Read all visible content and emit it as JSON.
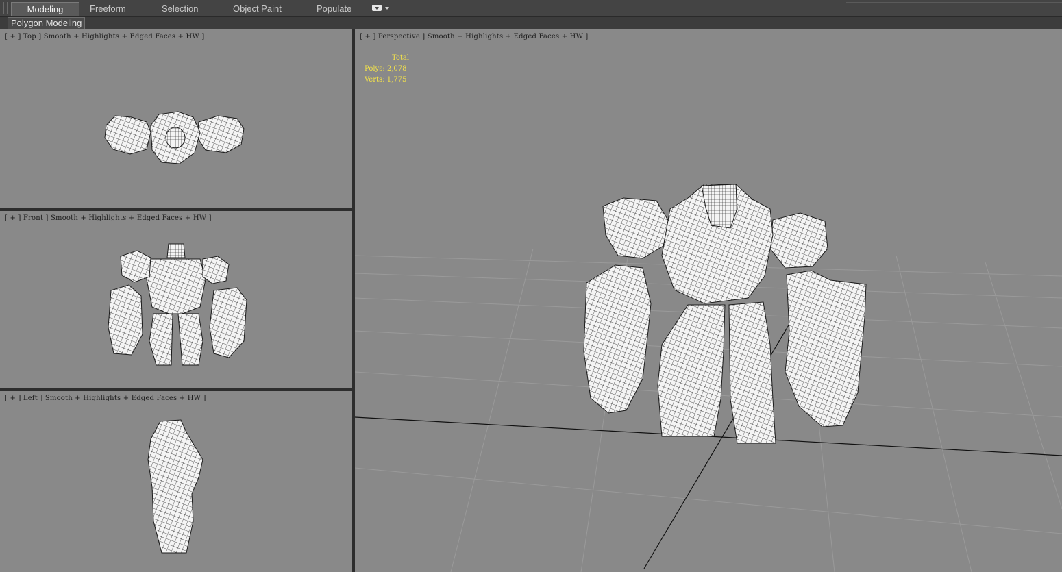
{
  "ribbon": {
    "tabs": [
      {
        "label": "Modeling",
        "active": true
      },
      {
        "label": "Freeform",
        "active": false
      },
      {
        "label": "Selection",
        "active": false
      },
      {
        "label": "Object Paint",
        "active": false
      },
      {
        "label": "Populate",
        "active": false
      }
    ],
    "panel_label": "Polygon Modeling",
    "dropdown_icon": "ribbon-options-icon"
  },
  "viewports": {
    "top": {
      "label": "[ + ] Top ] Smooth + Highlights + Edged Faces + HW ]"
    },
    "front": {
      "label": "[ + ] Front ] Smooth + Highlights + Edged Faces + HW ]"
    },
    "left": {
      "label": "[ + ] Left ] Smooth + Highlights + Edged Faces + HW ]"
    },
    "perspective": {
      "label": "[ + ] Perspective ] Smooth + Highlights + Edged Faces + HW ]",
      "stats": {
        "total": "Total",
        "polys": "Polys: 2,078",
        "verts": "Verts: 1,775"
      }
    }
  },
  "colors": {
    "viewport_bg": "#898989",
    "stats_text": "#f3e24a",
    "ribbon_bg": "#444444",
    "mesh_fill": "#f4f4f4",
    "mesh_wire": "#1a1a1a"
  }
}
